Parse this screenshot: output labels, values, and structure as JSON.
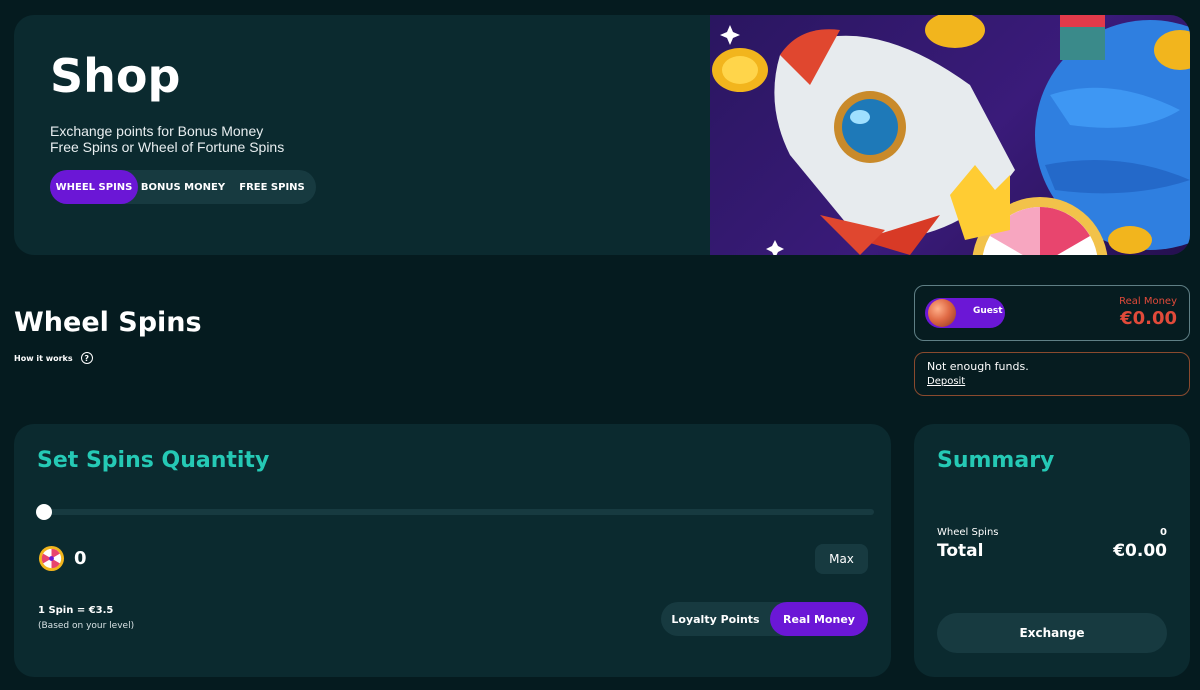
{
  "hero": {
    "title": "Shop",
    "subtitle_line1": "Exchange points for Bonus Money",
    "subtitle_line2": "Free Spins or Wheel of Fortune Spins",
    "tabs": [
      {
        "label": "WHEEL SPINS",
        "active": true
      },
      {
        "label": "BONUS MONEY",
        "active": false
      },
      {
        "label": "FREE SPINS",
        "active": false
      }
    ]
  },
  "section": {
    "title": "Wheel Spins",
    "how_it_works": "How it works"
  },
  "wallet": {
    "user_label": "Guest",
    "balance_label": "Real Money",
    "balance_amount": "€0.00"
  },
  "funds_notice": {
    "message": "Not enough funds.",
    "link": "Deposit"
  },
  "spins_card": {
    "title": "Set Spins Quantity",
    "quantity": "0",
    "slider_value_fraction": 0,
    "max_label": "Max",
    "rate": "1 Spin = €3.5",
    "rate_note": "(Based on your level)",
    "payment_options": [
      {
        "label": "Loyalty Points",
        "active": false
      },
      {
        "label": "Real Money",
        "active": true
      }
    ]
  },
  "summary": {
    "title": "Summary",
    "item_label": "Wheel Spins",
    "item_value": "0",
    "total_label": "Total",
    "total_value": "€0.00",
    "exchange_label": "Exchange"
  },
  "colors": {
    "accent_purple": "#6b17d6",
    "accent_teal": "#25c9b5",
    "warning_red": "#e14a3a"
  }
}
